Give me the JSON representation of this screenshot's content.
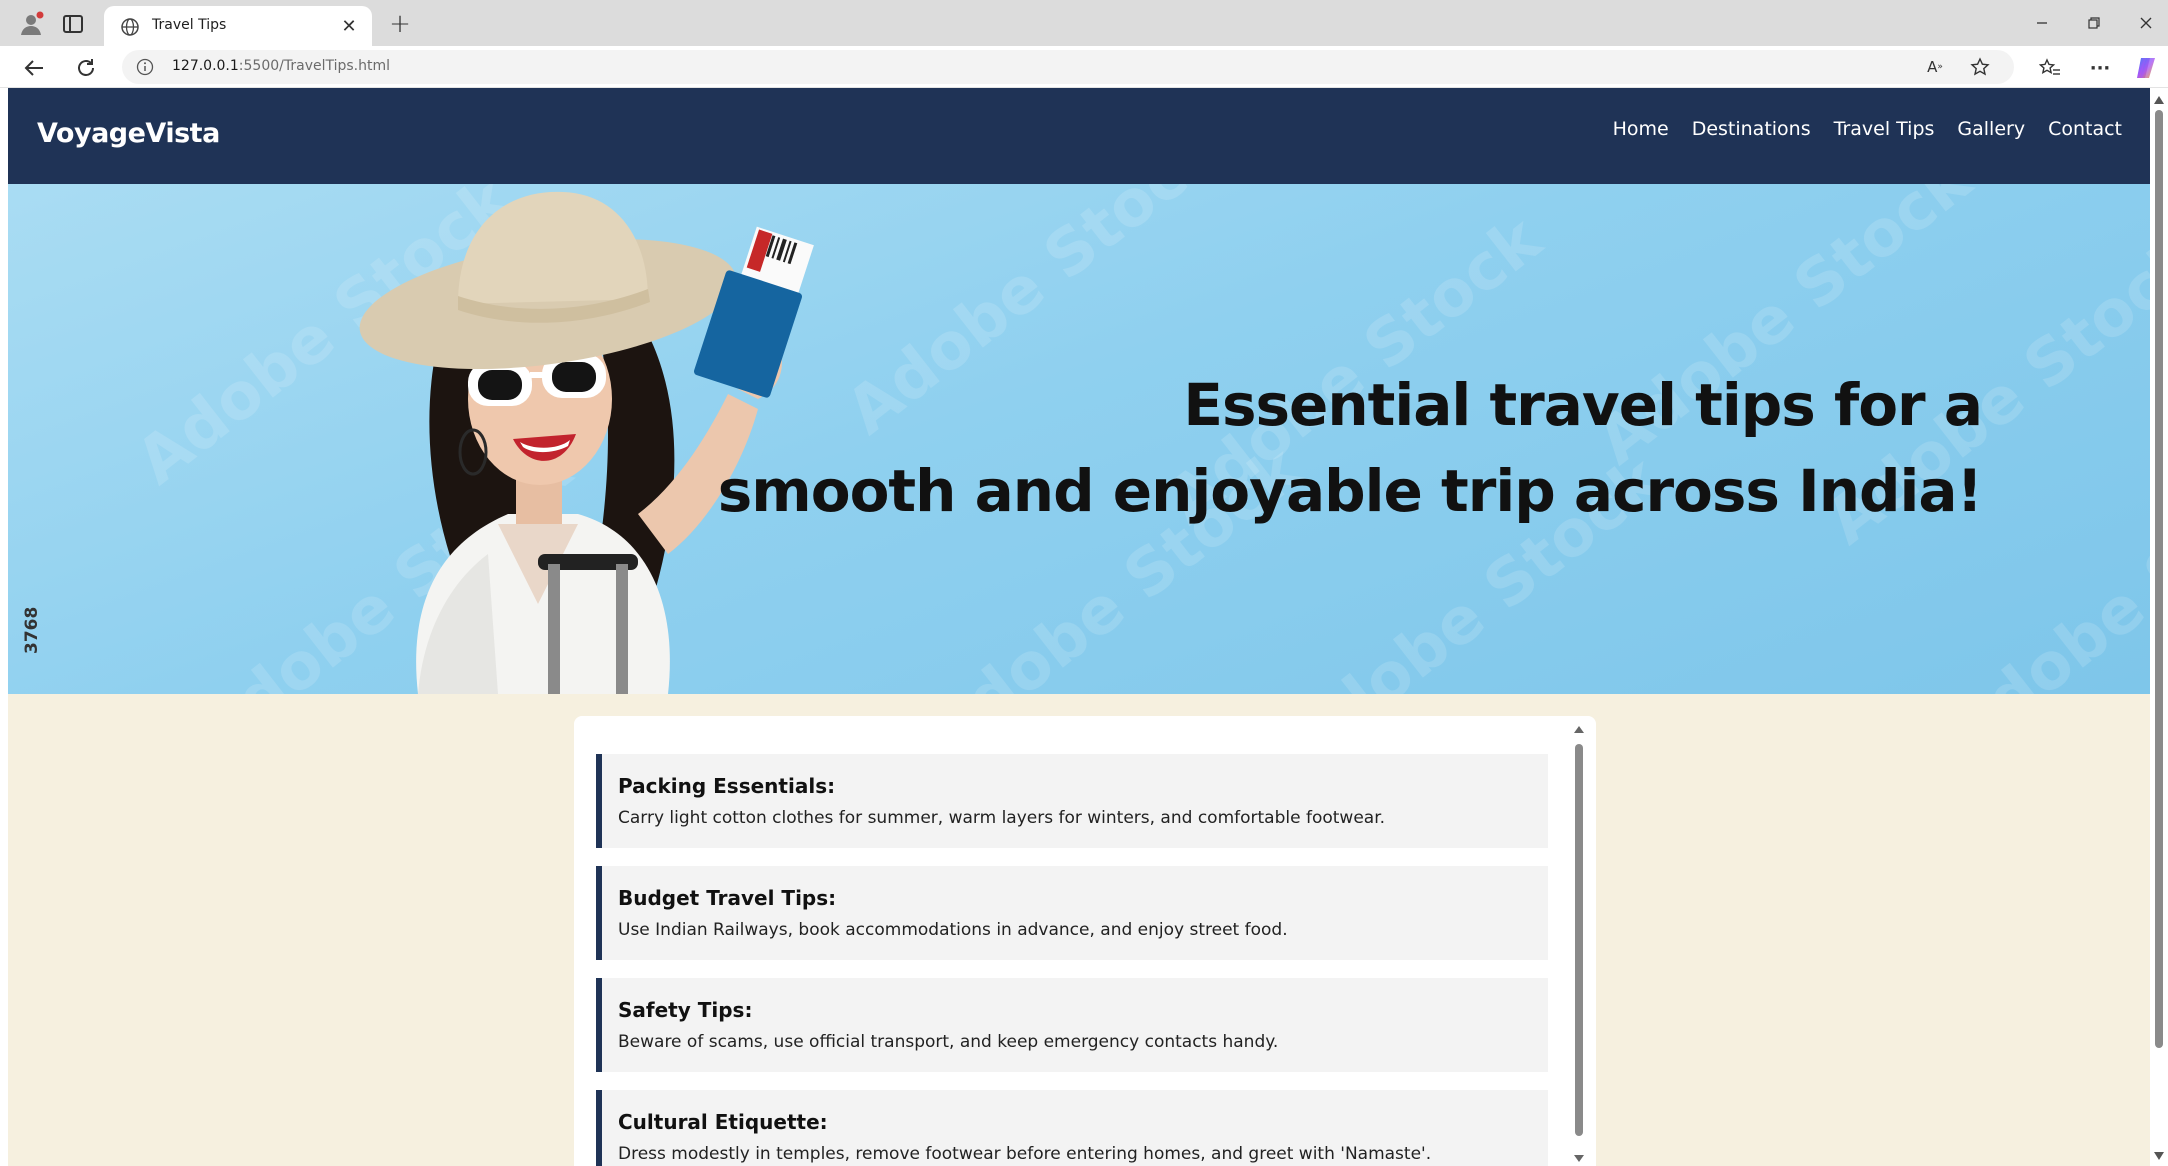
{
  "browser": {
    "tab_title": "Travel Tips",
    "url_host": "127.0.0.1",
    "url_path": ":5500/TravelTips.html"
  },
  "site": {
    "brand": "VoyageVista",
    "nav": [
      {
        "label": "Home"
      },
      {
        "label": "Destinations"
      },
      {
        "label": "Travel Tips"
      },
      {
        "label": "Gallery"
      },
      {
        "label": "Contact"
      }
    ]
  },
  "hero": {
    "line1": "Essential travel tips for a",
    "line2": "smooth and enjoyable trip across India!",
    "stock_id": "3768",
    "watermark": "Adobe Stock"
  },
  "tips": [
    {
      "title": "Packing Essentials:",
      "text": "Carry light cotton clothes for summer, warm layers for winters, and comfortable footwear."
    },
    {
      "title": "Budget Travel Tips:",
      "text": "Use Indian Railways, book accommodations in advance, and enjoy street food."
    },
    {
      "title": "Safety Tips:",
      "text": "Beware of scams, use official transport, and keep emergency contacts handy."
    },
    {
      "title": "Cultural Etiquette:",
      "text": "Dress modestly in temples, remove footwear before entering homes, and greet with 'Namaste'."
    }
  ],
  "colors": {
    "navbar": "#1f3356",
    "page_bg": "#f6f0df",
    "hero_bg": "#8fd0ef",
    "tip_accent": "#1f3356"
  },
  "icons": [
    "profile-icon",
    "tab-actions-icon",
    "globe-icon",
    "close-icon",
    "plus-icon",
    "minimize-icon",
    "restore-icon",
    "back-icon",
    "reload-icon",
    "info-icon",
    "read-aloud-icon",
    "favorite-star-icon",
    "favorites-icon",
    "more-icon",
    "copilot-icon"
  ]
}
